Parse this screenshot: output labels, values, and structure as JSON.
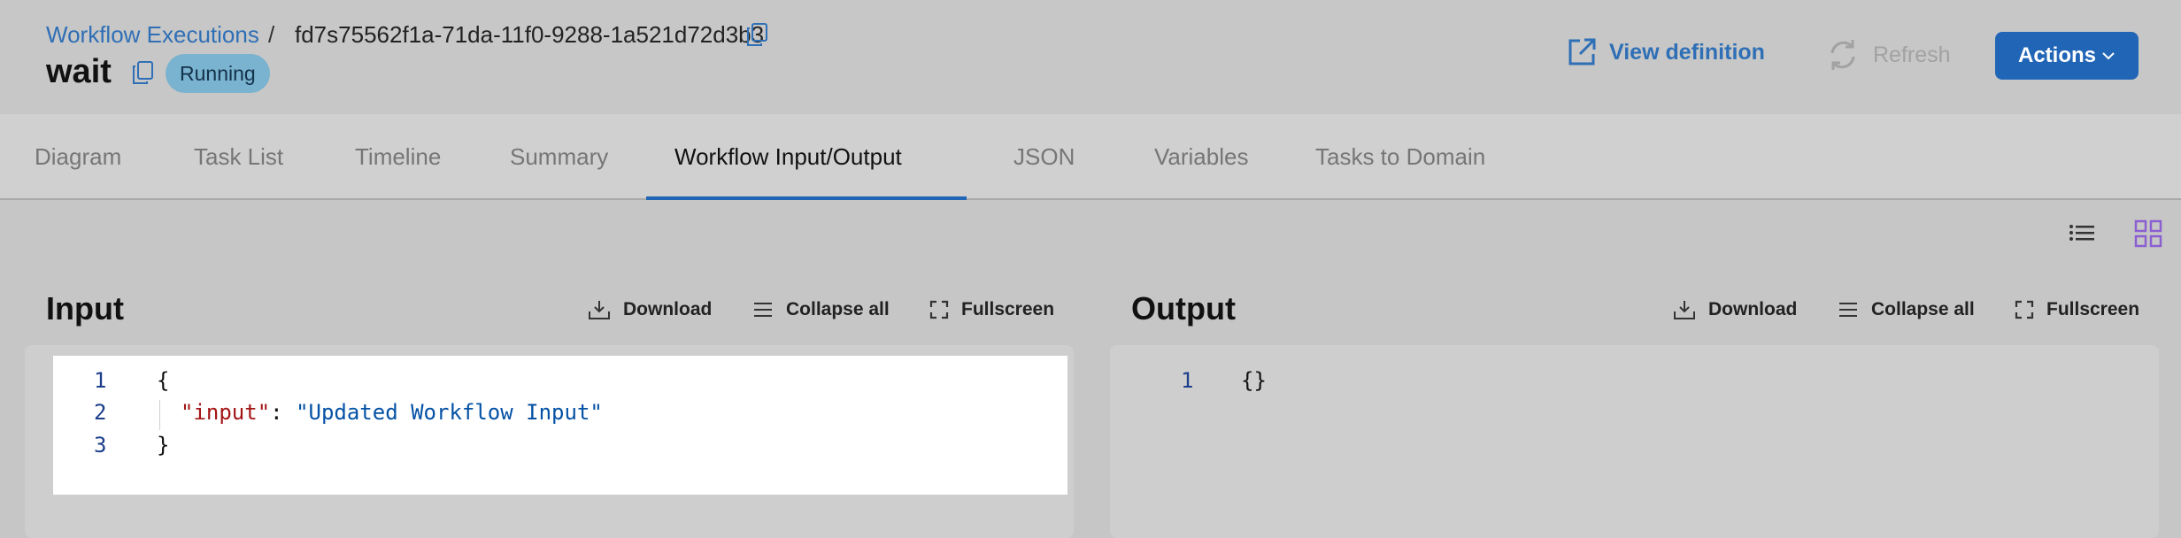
{
  "breadcrumb": {
    "parent": "Workflow Executions",
    "separator": "/",
    "execution_id": "fd7s75562f1a-71da-11f0-9288-1a521d72d3b3"
  },
  "workflow": {
    "name": "wait",
    "status": "Running"
  },
  "header_actions": {
    "view_definition": "View definition",
    "refresh": "Refresh",
    "actions": "Actions"
  },
  "tabs": [
    {
      "label": "Diagram"
    },
    {
      "label": "Task List"
    },
    {
      "label": "Timeline"
    },
    {
      "label": "Summary"
    },
    {
      "label": "Workflow Input/Output"
    },
    {
      "label": "JSON"
    },
    {
      "label": "Variables"
    },
    {
      "label": "Tasks to Domain"
    }
  ],
  "active_tab": "Workflow Input/Output",
  "input_panel": {
    "title": "Input",
    "download": "Download",
    "collapse_all": "Collapse all",
    "fullscreen": "Fullscreen",
    "lines": [
      {
        "n": "1",
        "text": "{"
      },
      {
        "n": "2",
        "key": "\"input\"",
        "colon": ": ",
        "value": "\"Updated Workflow Input\""
      },
      {
        "n": "3",
        "text": "}"
      }
    ]
  },
  "output_panel": {
    "title": "Output",
    "download": "Download",
    "collapse_all": "Collapse all",
    "fullscreen": "Fullscreen",
    "lines": [
      {
        "n": "1",
        "text": "{}"
      }
    ]
  },
  "colors": {
    "accent": "#2166b6",
    "link": "#2f6fb6",
    "badge": "#79b3cf",
    "grid_icon": "#8b5fd1"
  },
  "icons": [
    "copy-icon",
    "external-link-icon",
    "refresh-icon",
    "chevron-down-icon",
    "list-view-icon",
    "grid-view-icon",
    "download-icon",
    "collapse-all-icon",
    "fullscreen-icon"
  ]
}
